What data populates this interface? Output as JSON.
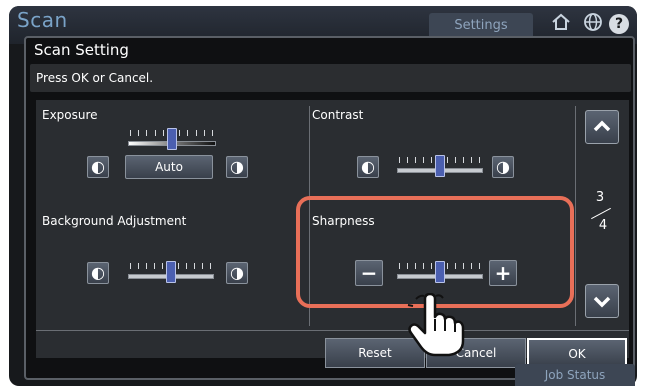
{
  "app": {
    "title": "Scan",
    "settings_tab": "Settings",
    "home_icon": "home-icon",
    "globe_icon": "globe-icon",
    "help_glyph": "?"
  },
  "dialog": {
    "title": "Scan Setting",
    "message": "Press OK or Cancel."
  },
  "exposure": {
    "label": "Exposure",
    "auto_label": "Auto",
    "decrease_icon": "light-half-moon-icon",
    "increase_icon": "dark-half-moon-icon"
  },
  "contrast": {
    "label": "Contrast"
  },
  "background": {
    "label": "Background Adjustment"
  },
  "sharpness": {
    "label": "Sharpness",
    "minus_glyph": "−",
    "plus_glyph": "+"
  },
  "levels": {
    "exposure": 0.5,
    "contrast": 0.5,
    "background": 0.5,
    "sharpness": 0.5
  },
  "pager": {
    "current": "3",
    "total": "4"
  },
  "footer": {
    "reset_label": "Reset",
    "cancel_label": "Cancel",
    "ok_label": "OK"
  },
  "status": {
    "job_status_label": "Job Status"
  },
  "colors": {
    "highlight": "#e86f58",
    "knob": "#4b5fb0",
    "title_accent": "#7aa3c8"
  }
}
